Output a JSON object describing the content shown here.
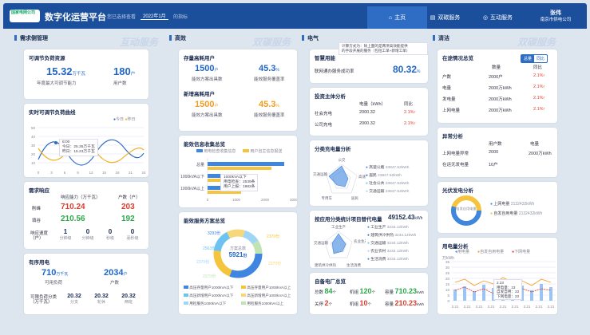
{
  "header": {
    "logo": "国家电网公司",
    "title": "数字化运营平台",
    "hint": "您已选择查看",
    "period": "2022年1月",
    "hint2": "的指标",
    "tabs": [
      "主页",
      "双碳服务",
      "互动服务"
    ],
    "user_name": "张伟",
    "user_org": "南京市供电公司"
  },
  "sections": {
    "demand": "需求侧管理",
    "demand_wm": "互动服务",
    "eff": "高效",
    "eff_wm": "双碳服务",
    "elec": "电气",
    "clean": "清洁",
    "clean_wm": "双碳服务"
  },
  "adjustable": {
    "title": "可调节负荷资源",
    "v1": "15.32",
    "u1": "万千瓦",
    "l1": "年度最大可调节能力",
    "v2": "180",
    "u2": "户",
    "l2": "用户数"
  },
  "realtime": {
    "title": "实时可调节负荷曲线",
    "legend_today": "今日",
    "legend_yday": "昨日",
    "tip_time": "8:00",
    "tip_today": "今日：25.35万千瓦",
    "tip_yday": "昨日：15.23万千瓦",
    "xticks": [
      "0",
      "3",
      "6",
      "9",
      "12",
      "15",
      "18",
      "21",
      "24"
    ],
    "yticks": [
      "50",
      "40",
      "30",
      "20",
      "10"
    ]
  },
  "response": {
    "title": "需求响应",
    "h1": "响应能力（万千瓦）",
    "h2": "户数（户）",
    "r1": "削峰",
    "r1v": "710.24",
    "r1n": "203",
    "r2": "填谷",
    "r2v": "210.56",
    "r2n": "192",
    "speed_label": "响应速度（户）",
    "speeds": [
      {
        "v": "1",
        "l": "分钟级"
      },
      {
        "v": "0",
        "l": "分钟级"
      },
      {
        "v": "0",
        "l": "秒级"
      },
      {
        "v": "0",
        "l": "毫秒级"
      }
    ]
  },
  "orderly": {
    "title": "有序用电",
    "v1": "710",
    "u1": "万千瓦",
    "l1": "可用负荷",
    "v2": "2034",
    "u2": "户",
    "l2": "户数",
    "l3": "可限负荷分类（万千瓦）",
    "items": [
      {
        "v": "20.32",
        "l": "分支"
      },
      {
        "v": "20.32",
        "l": "轮休"
      },
      {
        "v": "20.32",
        "l": "两班"
      }
    ]
  },
  "efficient": {
    "title": "存量高耗用户",
    "a1": "1500",
    "a1u": "户",
    "a1l": "能效方案出具数",
    "a2": "45.3",
    "a2u": "%",
    "a2l": "能效服务覆盖率",
    "title2": "新增高耗用户",
    "b1": "1500",
    "b1u": "户",
    "b1l": "能效方案出具数",
    "b2": "45.3",
    "b2u": "%",
    "b2l": "能效服务覆盖率"
  },
  "benefit": {
    "title": "能效信息收集总览",
    "leg1": "用电检查收集信息",
    "leg2": "用户自主信息报送",
    "cats": [
      "总量",
      "1000kVA以下",
      "1000kVA以上"
    ],
    "xticks": [
      "0",
      "1000",
      "2000",
      "3000"
    ],
    "tip_title": "1000kVA以下",
    "tip1": "用电检查：2539条",
    "tip2": "用户上报：1982条"
  },
  "plan": {
    "title": "能效服务方案总览",
    "center_label": "方案总数",
    "center_value": "5921",
    "center_unit": "份",
    "labels": [
      "3293份",
      "2563份",
      "2370份",
      "2370份",
      "2370份",
      "2370份"
    ],
    "legend": [
      "高压存量用户1000kVA以下",
      "高压存量用户1000kVA以上",
      "高压新增用户1000kVA以下",
      "高压新增用户1000kVA以上",
      "用检服务1000kVA以下",
      "用检服务1000kVA以上"
    ]
  },
  "smart": {
    "title": "智慧用能",
    "tip": "计算方式为：除上面的是两项高效能提供",
    "tip2": "的手段开展的服务（包括工单+新增工单）",
    "label": "联网通办服务成功率",
    "value": "80.32",
    "unit": "%"
  },
  "invest": {
    "title": "投资主体分析",
    "h1": "电量（kWh）",
    "h2": "同比",
    "rows": [
      {
        "n": "社会充电",
        "v": "2000.32",
        "p": "2.1%"
      },
      {
        "n": "公司充电",
        "v": "2000.32",
        "p": "2.1%"
      }
    ]
  },
  "classify": {
    "title": "分类充电量分析",
    "axes": [
      "公交",
      "高速公路",
      "居民",
      "专用车",
      "交通运输"
    ],
    "items": [
      {
        "n": "高速公路",
        "v": "23847.52kWh"
      },
      {
        "n": "居民",
        "v": "23847.52kWh"
      },
      {
        "n": "社会公共",
        "v": "23847.52kWh"
      },
      {
        "n": "交通运输",
        "v": "23847.52kWh"
      }
    ]
  },
  "replace": {
    "title": "按应用分类统计项目替代电量",
    "value": "49152.43",
    "unit": "kWh",
    "axes": [
      "工业生产",
      "农业生产",
      "交通运输",
      "建筑供冷供热",
      "生活消费"
    ],
    "items": [
      {
        "n": "工业生产",
        "v": "3234.12kWh"
      },
      {
        "n": "建筑供冷供热",
        "v": "3234.12kWh"
      },
      {
        "n": "交通运输",
        "v": "3234.12kWh"
      },
      {
        "n": "农业农村",
        "v": "3234.12kWh"
      },
      {
        "n": "生活消费",
        "v": "3234.12kWh"
      }
    ]
  },
  "self": {
    "title": "自备电厂总览",
    "r1": [
      {
        "l": "总数",
        "v": "84",
        "u": "个"
      },
      {
        "l": "机组",
        "v": "120",
        "u": "个"
      },
      {
        "l": "容量",
        "v": "710.23",
        "u": "kWh"
      }
    ],
    "r2": [
      {
        "l": "关停",
        "v": "2",
        "u": "个"
      },
      {
        "l": "机组",
        "v": "10",
        "u": "个"
      },
      {
        "l": "容量",
        "v": "210.23",
        "u": "kWh"
      }
    ]
  },
  "replacement": {
    "title": "在途情况总览",
    "tab1": "总量",
    "tab2": "同比",
    "h1": "数量",
    "h2": "同比",
    "rows": [
      {
        "n": "户数",
        "v": "2000户",
        "p": "2.1%"
      },
      {
        "n": "电量",
        "v": "2000万kWh",
        "p": "2.1%"
      },
      {
        "n": "发电量",
        "v": "2000万kWh",
        "p": "2.1%"
      },
      {
        "n": "上网电量",
        "v": "2000万kWh",
        "p": "2.1%"
      }
    ]
  },
  "abnormal": {
    "title": "异常分析",
    "h1": "用户数",
    "h2": "电量",
    "rows": [
      {
        "n": "上网电量异常",
        "a": "2000",
        "b": "2000万kWh"
      },
      {
        "n": "在运无发电量",
        "a": "10户",
        "b": ""
      }
    ]
  },
  "pvcontract": {
    "title": "光伏发电分析",
    "center": "自发自用电量",
    "leg": [
      {
        "n": "上网电量",
        "v": "2132432kWh"
      },
      {
        "n": "自发自用电量",
        "v": "2132432kWh"
      }
    ]
  },
  "load": {
    "title": "用电量分析",
    "leg": [
      "用电量",
      "自发自用电量",
      "下网电量"
    ],
    "unit": "万kWh",
    "tip_date": "2.23",
    "tip1": "用电量：23",
    "tip2": "自发自用：23",
    "tip3": "下网电量：23",
    "xticks": [
      "2.21",
      "2.21",
      "2.21",
      "2.21",
      "2.21",
      "2.21",
      "2.21",
      "2.21",
      "2.21"
    ],
    "yticks": [
      "35",
      "30",
      "25",
      "20",
      "15",
      "10",
      "5",
      "0"
    ]
  },
  "colors": {
    "nav": "#1b4f9c",
    "blue": "#1f66c8",
    "orange": "#f29c1f",
    "red": "#e23b2e",
    "green": "#2ba84a"
  }
}
